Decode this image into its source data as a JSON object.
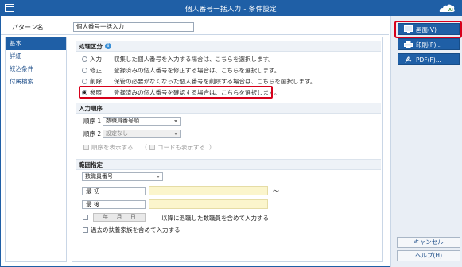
{
  "window": {
    "title": "個人番号一括入力 - 条件設定"
  },
  "pattern": {
    "label": "パターン名",
    "value": "個人番号一括入力"
  },
  "sidebar": {
    "items": [
      {
        "label": "基本",
        "active": true
      },
      {
        "label": "詳細",
        "active": false
      },
      {
        "label": "絞込条件",
        "active": false
      },
      {
        "label": "付属検索",
        "active": false
      }
    ]
  },
  "processing": {
    "header": "処理区分",
    "options": [
      {
        "label": "入力",
        "desc": "収集した個人番号を入力する場合は、こちらを選択します。",
        "selected": false
      },
      {
        "label": "修正",
        "desc": "登録済みの個人番号を修正する場合は、こちらを選択します。",
        "selected": false
      },
      {
        "label": "削除",
        "desc": "保管の必要がなくなった個人番号を削除する場合は、こちらを選択します。",
        "selected": false
      },
      {
        "label": "参照",
        "desc": "登録済みの個人番号を確認する場合は、こちらを選択します。",
        "selected": true
      }
    ]
  },
  "input_order": {
    "header": "入力順序",
    "order1_label": "順序 1",
    "order1_value": "数職員番号順",
    "order2_label": "順序 2",
    "order2_value": "設定なし",
    "show_order": "順序を表示する",
    "paren_open": "（",
    "show_code": "コードも表示する",
    "paren_close": "）"
  },
  "range": {
    "header": "範囲指定",
    "select_value": "数職員番号",
    "first_label": "最 初",
    "last_label": "最 後",
    "tilde": "〜",
    "date_year": "年",
    "date_month": "月",
    "date_day": "日",
    "after_retire_text": "以降に退職した数職員を含めて入力する",
    "past_dependents_text": "過去の扶養家族を含めて入力する"
  },
  "buttons": {
    "display": "画面(V)",
    "print": "印刷(P)...",
    "pdf": "PDF(F)...",
    "cancel": "キャンセル",
    "help": "ヘルプ(H)"
  },
  "colors": {
    "titlebar": "#1f5fa6",
    "accent": "#1f5fa6",
    "highlight": "#d7001b",
    "range_input": "#fbf5cc"
  }
}
